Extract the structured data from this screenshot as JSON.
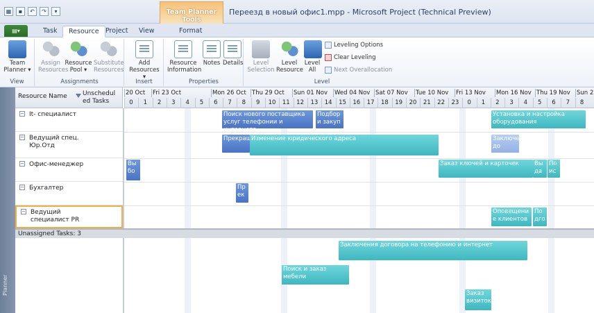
{
  "window": {
    "title": "Переезд в новый офис1.mpp  -  Microsoft Project (Technical Preview)",
    "context_tab_group": "Team Planner Tools"
  },
  "tabs": [
    "Task",
    "Resource",
    "Project",
    "View",
    "Format"
  ],
  "active_tab": "Resource",
  "ribbon": {
    "view": {
      "label": "View",
      "team_planner": "Team Planner ▾"
    },
    "assignments": {
      "label": "Assignments",
      "assign": "Assign Resources",
      "pool": "Resource Pool ▾",
      "substitute": "Substitute Resources"
    },
    "insert": {
      "label": "Insert",
      "add": "Add Resources ▾"
    },
    "properties": {
      "label": "Properties",
      "info": "Resource Information",
      "notes": "Notes",
      "details": "Details"
    },
    "level": {
      "label": "Level",
      "selection": "Level Selection",
      "resource": "Level Resource",
      "all": "Level All",
      "options": "Leveling Options",
      "clear": "Clear Leveling",
      "next": "Next Overallocation"
    }
  },
  "grid": {
    "col_name": "Resource Name",
    "col_unscheduled": "Unschedul ed Tasks",
    "date_headers": [
      "20 Oct",
      "Fri 23 Oct",
      "Mon 26 Oct",
      "Thu 29 Oct",
      "Sun 01 Nov",
      "Wed 04 Nov",
      "Sat 07 Nov",
      "Tue 10 Nov",
      "Fri 13 Nov",
      "Mon 16 Nov",
      "Thu 19 Nov",
      "Sun 22 Nov"
    ],
    "day_numbers": [
      "0",
      "1",
      "2",
      "3",
      "4",
      "5",
      "6",
      "7",
      "8",
      "9",
      "10",
      "11",
      "12",
      "13",
      "14",
      "15",
      "16",
      "17",
      "18",
      "19",
      "20",
      "21",
      "22",
      "23",
      "0",
      "1",
      "2",
      "3",
      "4",
      "5",
      "6",
      "7",
      "8"
    ],
    "unassigned_label": "Unassigned Tasks: 3"
  },
  "resources": [
    {
      "name": "It- специалист"
    },
    {
      "name": "Ведущий спец. Юр.Отд"
    },
    {
      "name": "Офис-менеджер"
    },
    {
      "name": "Бухгалтер"
    },
    {
      "name": "Ведущий специалист PR"
    }
  ],
  "tasks": {
    "t1": "Поиск нового поставщика услуг телефонии и интернета",
    "t2": "Подбор и закуп",
    "t3": "Установка и настройка оборудования",
    "t4": "Прекращение",
    "t5": "Изменение юридического адреса",
    "t6": "Заключение до",
    "t7": "Вы бо",
    "t8": "Заказ ключей и карточек",
    "t9": "Вы да",
    "t10": "По ис",
    "t11": "Пр ек",
    "t12": "Оповещени е клиентов",
    "t13": "По дго",
    "t14": "Заключения договора на телефонию и интернет",
    "t15": "Поиск и заказ мебели",
    "t16": "Заказ визиток"
  },
  "view_label": "Planner"
}
